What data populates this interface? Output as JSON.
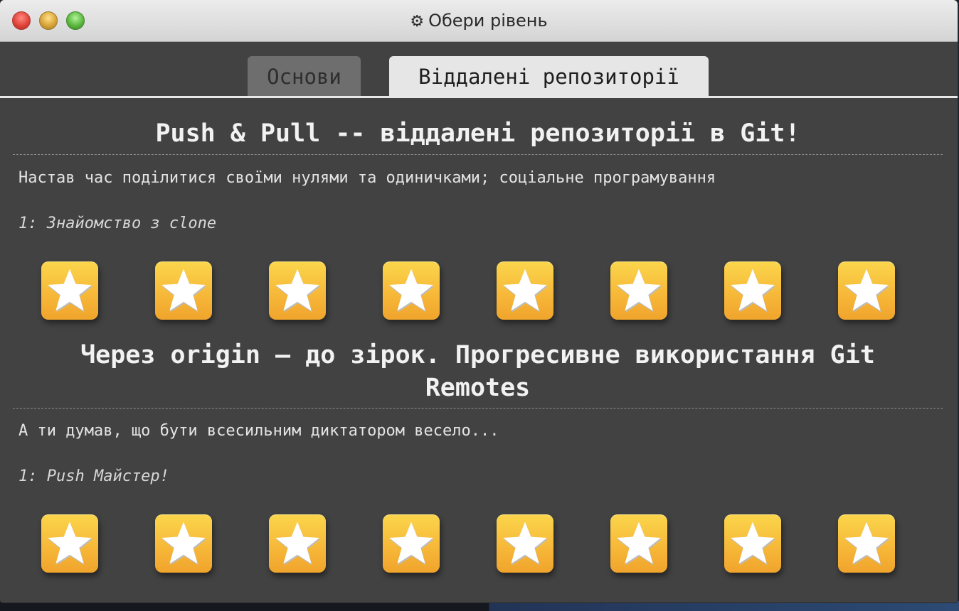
{
  "window": {
    "title": "Обери рівень",
    "title_icon": "gear-icon"
  },
  "tabs": [
    {
      "label": "Основи",
      "active": false
    },
    {
      "label": "Віддалені репозиторії",
      "active": true
    }
  ],
  "sections": [
    {
      "title": "Push & Pull -- віддалені репозиторії в Git!",
      "description": "Настав час поділитися своїми нулями та одиничками; соціальне програмування",
      "level_label": "1: Знайомство з clone",
      "levels": [
        "star-icon",
        "star-icon",
        "star-icon",
        "star-icon",
        "star-icon",
        "star-icon",
        "star-icon",
        "star-icon"
      ]
    },
    {
      "title": "Через origin – до зірок. Прогресивне використання Git Remotes",
      "description": "А ти думав, що бути всесильним диктатором весело...",
      "level_label": "1: Push Майстер!",
      "levels": [
        "star-icon",
        "star-icon",
        "star-icon",
        "star-icon",
        "star-icon",
        "star-icon",
        "star-icon",
        "star-icon"
      ]
    }
  ],
  "colors": {
    "background": "#424242",
    "star_button": "#f7b93a",
    "active_tab": "#e6e6e6",
    "inactive_tab": "#6e6e6e"
  }
}
